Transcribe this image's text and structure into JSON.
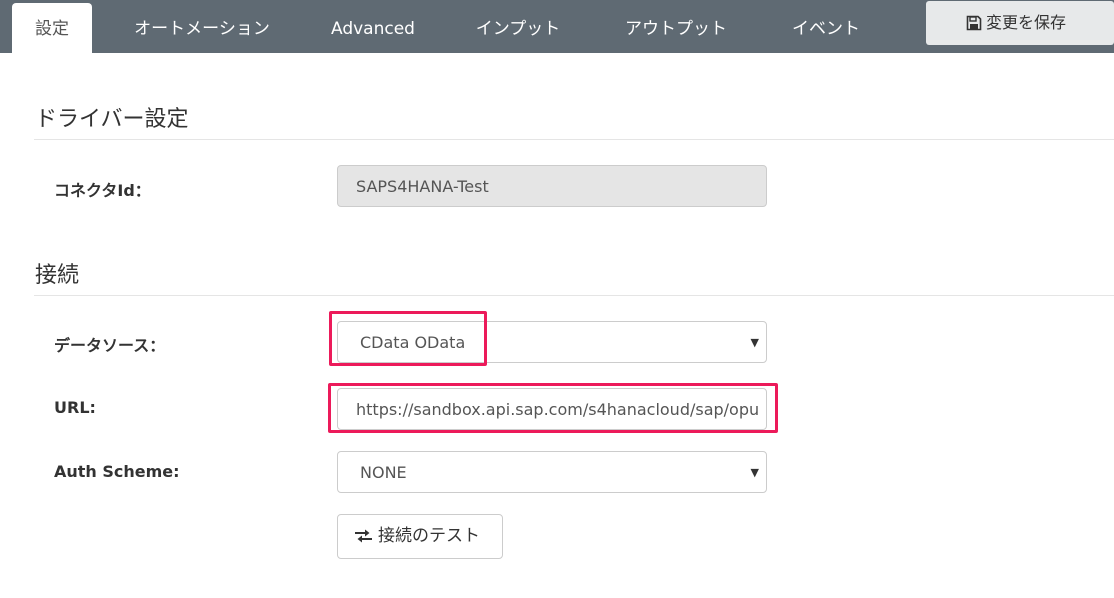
{
  "tabs": [
    {
      "label": "設定",
      "active": true
    },
    {
      "label": "オートメーション",
      "active": false
    },
    {
      "label": "Advanced",
      "active": false
    },
    {
      "label": "インプット",
      "active": false
    },
    {
      "label": "アウトプット",
      "active": false
    },
    {
      "label": "イベント",
      "active": false
    }
  ],
  "toolbar": {
    "save_label": "変更を保存",
    "save_icon": "floppy-disk-icon"
  },
  "driver_section": {
    "title": "ドライバー設定",
    "connector_id_label": "コネクタId：",
    "connector_id_value": "SAPS4HANA-Test"
  },
  "connection_section": {
    "title": "接続",
    "datasource_label": "データソース：",
    "datasource_value": "CData OData",
    "url_label": "URL:",
    "url_value": "https://sandbox.api.sap.com/s4hanacloud/sap/opu",
    "auth_label": "Auth Scheme:",
    "auth_value": "NONE",
    "test_button_label": "接続のテスト",
    "test_button_icon": "exchange-arrows-icon"
  },
  "colors": {
    "topbar": "#5f6a73",
    "highlight": "#ec1a5a",
    "readonly_bg": "#e5e5e5"
  }
}
